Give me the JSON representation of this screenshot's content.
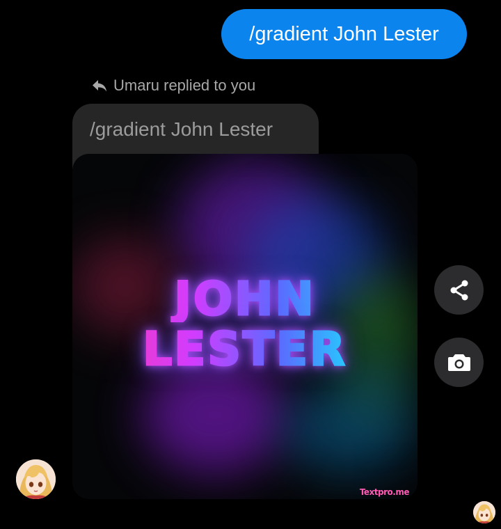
{
  "outgoing_message": {
    "text": "/gradient John Lester",
    "color": "#0b84ee"
  },
  "reply": {
    "indicator_text": "Umaru replied to you",
    "indicator_icon": "reply-arrow-icon",
    "quoted_text": "/gradient John Lester"
  },
  "image_message": {
    "line1": "JOHN",
    "line2": "LESTER",
    "watermark": "Textpro.me"
  },
  "actions": {
    "share_icon": "share-icon",
    "camera_icon": "camera-icon"
  },
  "avatars": {
    "sender_avatar": "anime-girl-avatar",
    "seen_avatar": "anime-girl-avatar"
  }
}
